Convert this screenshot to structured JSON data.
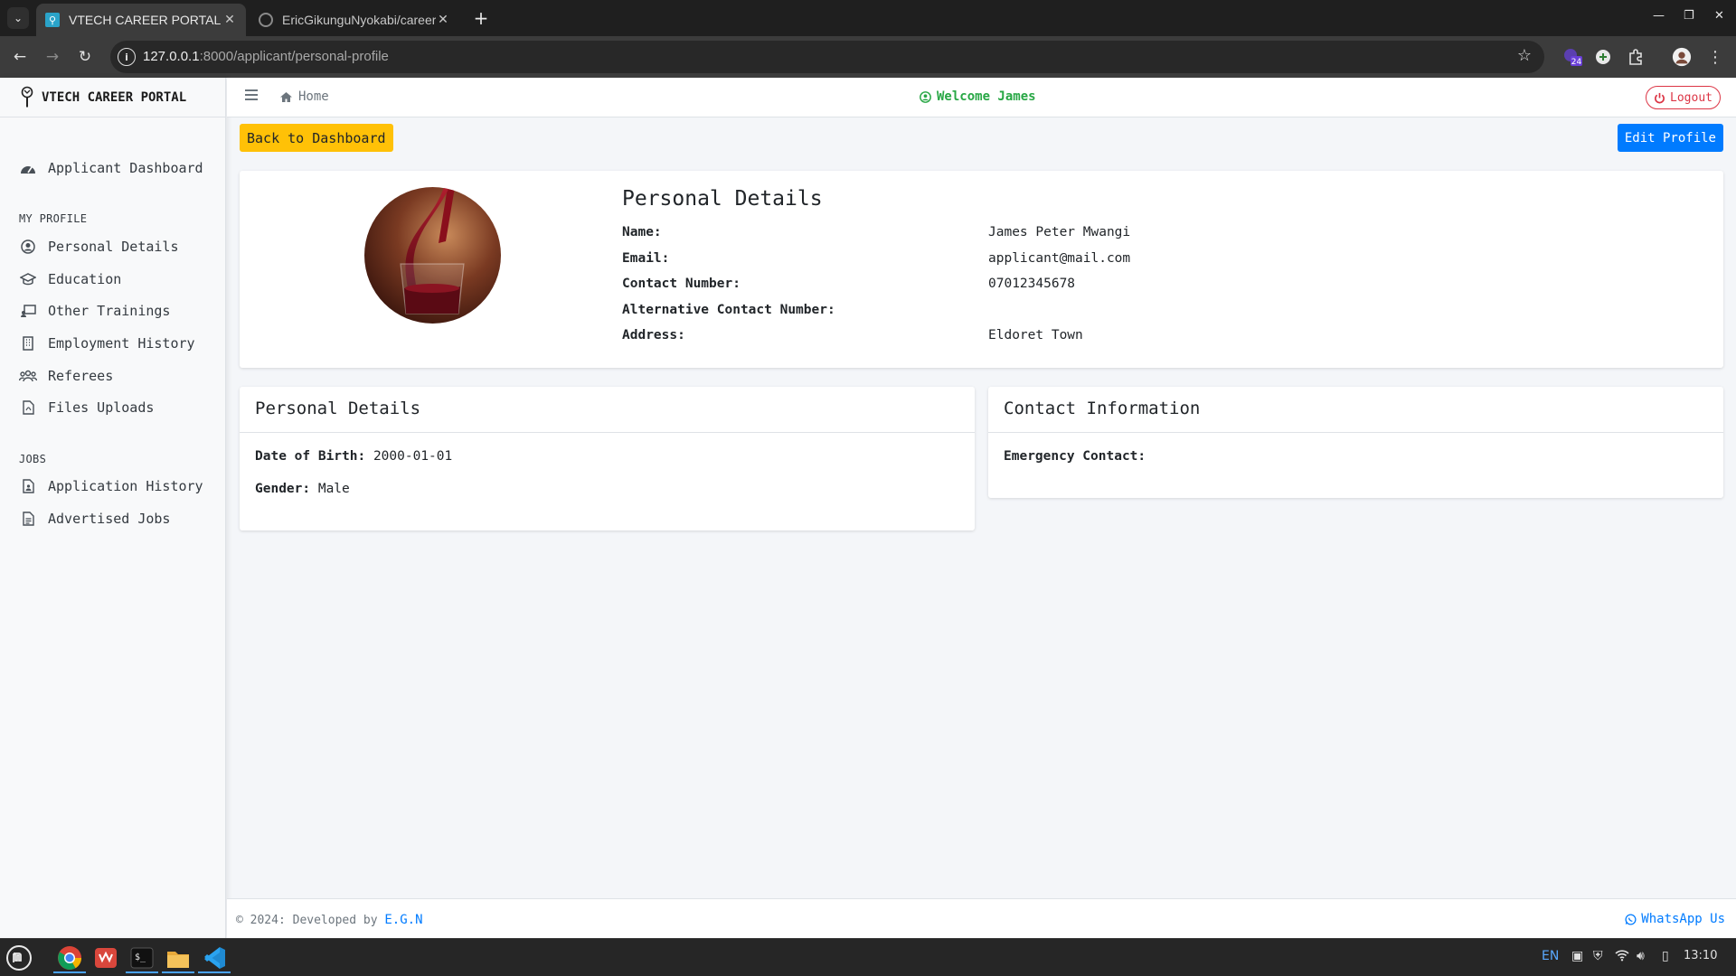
{
  "browser": {
    "tabs": [
      {
        "title": "VTECH CAREER PORTAL",
        "active": true
      },
      {
        "title": "EricGikunguNyokabi/career-"
      }
    ],
    "url_host": "127.0.0.1",
    "url_path": ":8000/applicant/personal-profile",
    "extension_badge": "24"
  },
  "brand": {
    "name": "VTECH CAREER PORTAL"
  },
  "sidebar": {
    "dashboard": "Applicant Dashboard",
    "my_profile_heading": "MY PROFILE",
    "profile_items": [
      {
        "label": "Personal Details",
        "icon": "user-circle-icon"
      },
      {
        "label": "Education",
        "icon": "graduation-cap-icon"
      },
      {
        "label": "Other Trainings",
        "icon": "chalkboard-teacher-icon"
      },
      {
        "label": "Employment History",
        "icon": "building-icon"
      },
      {
        "label": "Referees",
        "icon": "users-icon"
      },
      {
        "label": "Files Uploads",
        "icon": "file-pdf-icon"
      }
    ],
    "jobs_heading": "JOBS",
    "jobs_items": [
      {
        "label": "Application History",
        "icon": "file-user-icon"
      },
      {
        "label": "Advertised Jobs",
        "icon": "file-alt-icon"
      }
    ]
  },
  "topnav": {
    "home_label": "Home",
    "welcome": "Welcome James",
    "logout": "Logout"
  },
  "actions": {
    "back": "Back to Dashboard",
    "edit": "Edit Profile"
  },
  "profile": {
    "title": "Personal Details",
    "rows": [
      {
        "label": "Name:",
        "value": "James Peter Mwangi"
      },
      {
        "label": "Email:",
        "value": "applicant@mail.com"
      },
      {
        "label": "Contact Number:",
        "value": "07012345678"
      },
      {
        "label": "Alternative Contact Number:",
        "value": ""
      },
      {
        "label": "Address:",
        "value": "Eldoret Town"
      }
    ]
  },
  "personal_details_card": {
    "title": "Personal Details",
    "dob_label": "Date of Birth:",
    "dob_value": "2000-01-01",
    "gender_label": "Gender:",
    "gender_value": "Male"
  },
  "contact_card": {
    "title": "Contact Information",
    "emergency_label": "Emergency Contact:",
    "emergency_value": ""
  },
  "footer": {
    "copy": "© 2024: Developed by",
    "author": "E.G.N",
    "whatsapp": "WhatsApp Us"
  },
  "system": {
    "lang": "EN",
    "time": "13:10"
  },
  "colors": {
    "accent_warning": "#ffc107",
    "accent_primary": "#007bff",
    "welcome_green": "#28a745",
    "logout_red": "#dc3545"
  }
}
